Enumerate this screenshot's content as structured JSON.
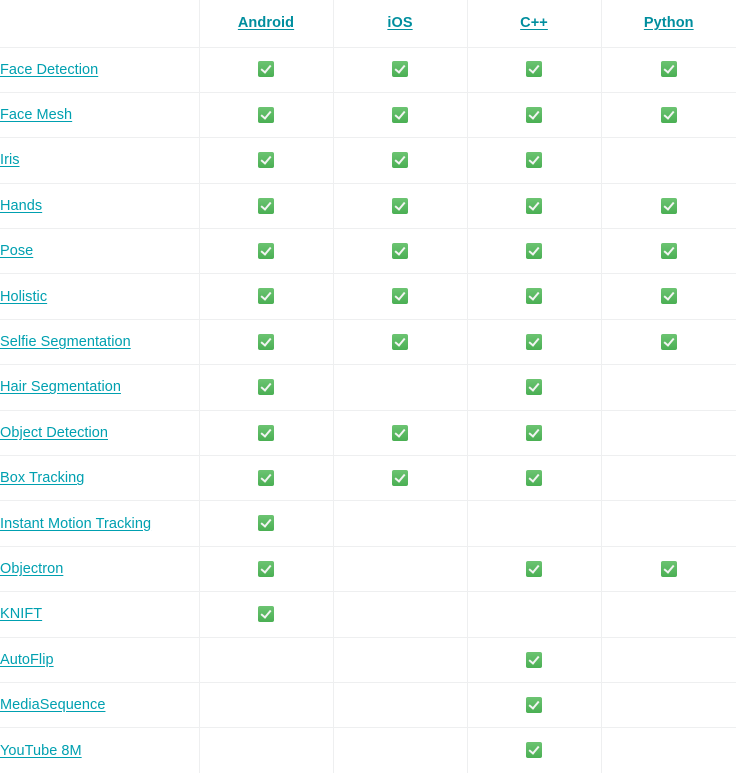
{
  "table": {
    "columns": [
      {
        "key": "solution",
        "label": "",
        "icon": ""
      },
      {
        "key": "android",
        "label": "Android"
      },
      {
        "key": "ios",
        "label": "iOS"
      },
      {
        "key": "cpp",
        "label": "C++"
      },
      {
        "key": "python",
        "label": "Python"
      }
    ],
    "check_glyph": "check-mark-button-icon",
    "colors": {
      "link": "#00a0b0",
      "header_link": "#008e9e",
      "border": "#eeeff0",
      "check_green": "#4aaf53",
      "background": "#ffffff"
    },
    "rows": [
      {
        "solution": "Face Detection",
        "android": true,
        "ios": true,
        "cpp": true,
        "python": true
      },
      {
        "solution": "Face Mesh",
        "android": true,
        "ios": true,
        "cpp": true,
        "python": true
      },
      {
        "solution": "Iris",
        "android": true,
        "ios": true,
        "cpp": true,
        "python": false
      },
      {
        "solution": "Hands",
        "android": true,
        "ios": true,
        "cpp": true,
        "python": true
      },
      {
        "solution": "Pose",
        "android": true,
        "ios": true,
        "cpp": true,
        "python": true
      },
      {
        "solution": "Holistic",
        "android": true,
        "ios": true,
        "cpp": true,
        "python": true
      },
      {
        "solution": "Selfie Segmentation",
        "android": true,
        "ios": true,
        "cpp": true,
        "python": true
      },
      {
        "solution": "Hair Segmentation",
        "android": true,
        "ios": false,
        "cpp": true,
        "python": false
      },
      {
        "solution": "Object Detection",
        "android": true,
        "ios": true,
        "cpp": true,
        "python": false
      },
      {
        "solution": "Box Tracking",
        "android": true,
        "ios": true,
        "cpp": true,
        "python": false
      },
      {
        "solution": "Instant Motion Tracking",
        "android": true,
        "ios": false,
        "cpp": false,
        "python": false
      },
      {
        "solution": "Objectron",
        "android": true,
        "ios": false,
        "cpp": true,
        "python": true
      },
      {
        "solution": "KNIFT",
        "android": true,
        "ios": false,
        "cpp": false,
        "python": false
      },
      {
        "solution": "AutoFlip",
        "android": false,
        "ios": false,
        "cpp": true,
        "python": false
      },
      {
        "solution": "MediaSequence",
        "android": false,
        "ios": false,
        "cpp": true,
        "python": false
      },
      {
        "solution": "YouTube 8M",
        "android": false,
        "ios": false,
        "cpp": true,
        "python": false
      }
    ]
  }
}
